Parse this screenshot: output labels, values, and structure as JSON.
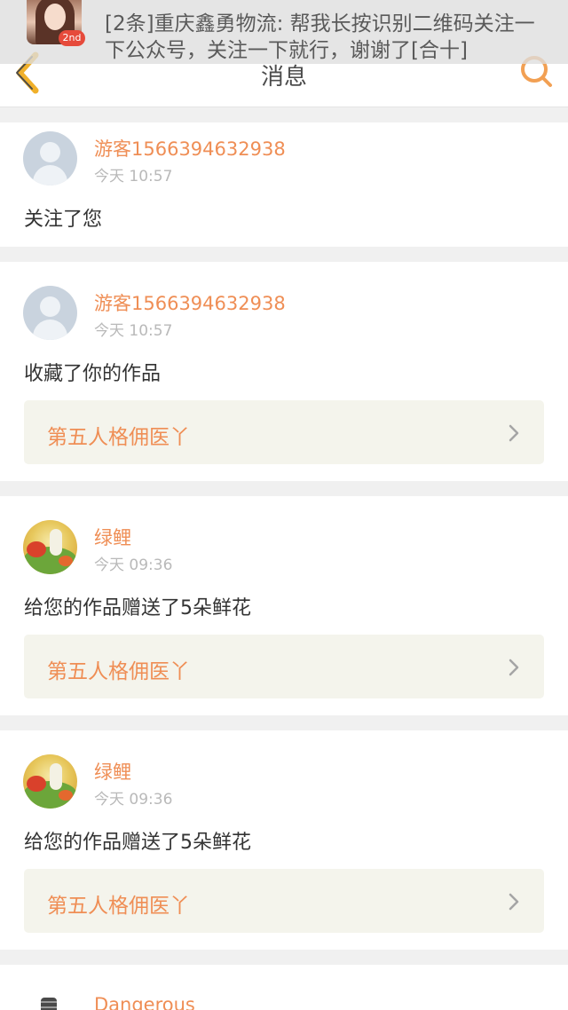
{
  "notification": {
    "badge": "2nd",
    "text": "[2条]重庆鑫勇物流: 帮我长按识别二维码关注一下公众号，关注一下就行，谢谢了[合十]"
  },
  "header": {
    "title": "消息",
    "back_icon": "back-chevron-icon",
    "search_icon": "search-icon"
  },
  "colors": {
    "accent": "#ef8e55",
    "background": "#f0f0f0",
    "card": "#ffffff",
    "link_box": "#f4f4ec"
  },
  "messages": [
    {
      "user": "游客1566394632938",
      "time": "今天 10:57",
      "action": "关注了您"
    },
    {
      "user": "游客1566394632938",
      "time": "今天 10:57",
      "action": "收藏了你的作品",
      "work": "第五人格佣医丫"
    },
    {
      "user": "绿鲤",
      "time": "今天 09:36",
      "action": "给您的作品赠送了5朵鲜花",
      "work": "第五人格佣医丫"
    },
    {
      "user": "绿鲤",
      "time": "今天 09:36",
      "action": "给您的作品赠送了5朵鲜花",
      "work": "第五人格佣医丫"
    },
    {
      "user": "Dangerous"
    }
  ]
}
